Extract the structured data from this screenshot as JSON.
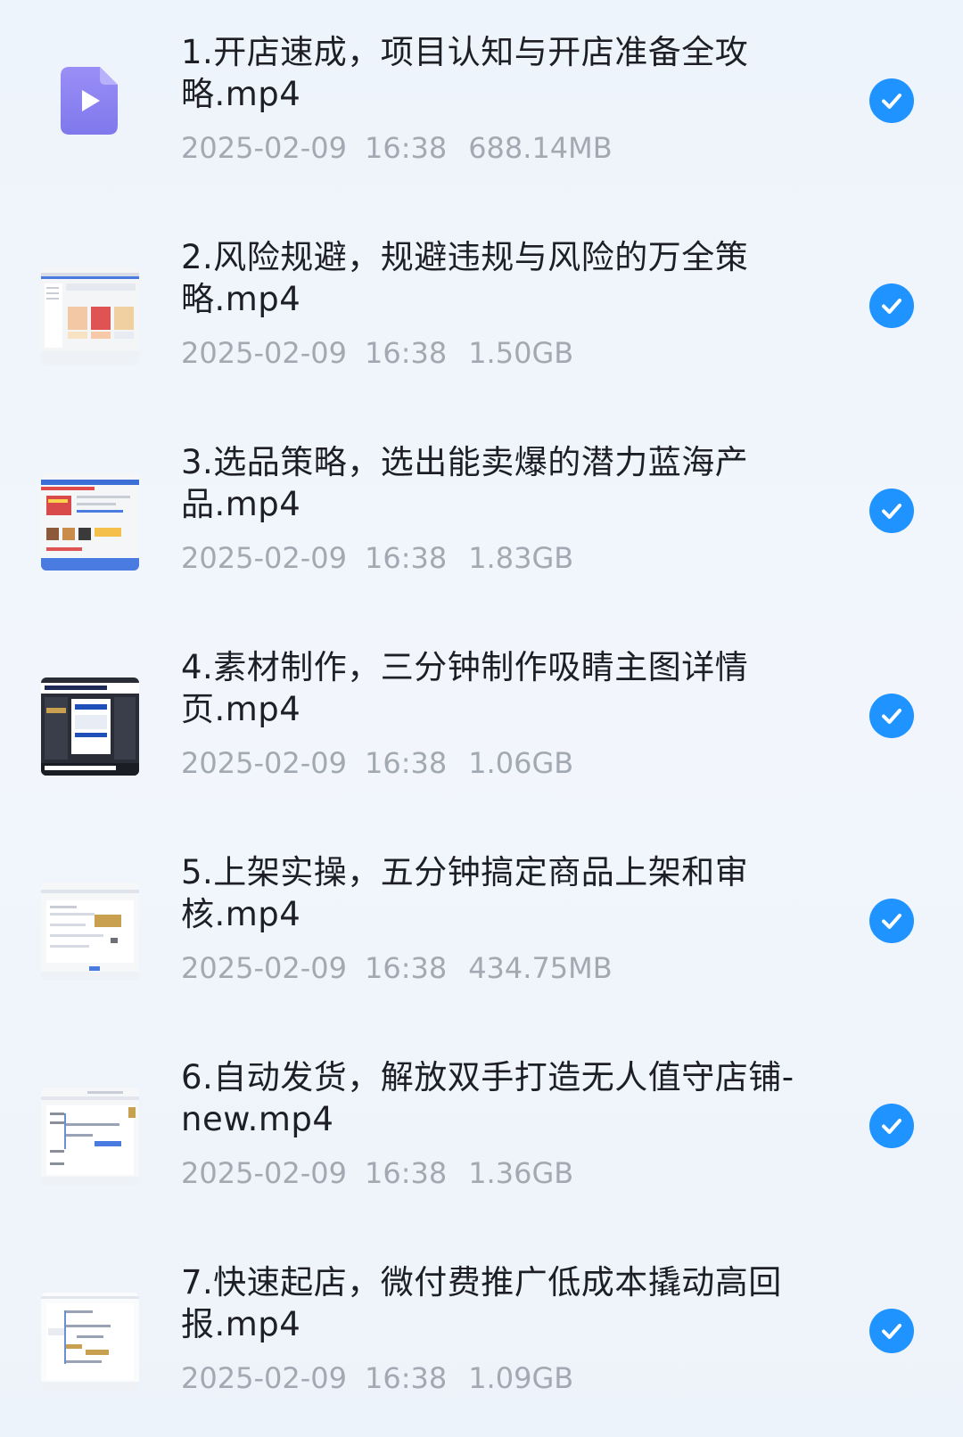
{
  "files": [
    {
      "name": "1.开店速成，项目认知与开店准备全攻略.mp4",
      "date": "2025-02-09",
      "time": "16:38",
      "size": "688.14MB",
      "thumb": "video-file-icon",
      "selected": true
    },
    {
      "name": "2.风险规避，规避违规与风险的万全策略.mp4",
      "date": "2025-02-09",
      "time": "16:38",
      "size": "1.50GB",
      "thumb": "video-thumbnail",
      "selected": true
    },
    {
      "name": "3.选品策略，选出能卖爆的潜力蓝海产品.mp4",
      "date": "2025-02-09",
      "time": "16:38",
      "size": "1.83GB",
      "thumb": "video-thumbnail",
      "selected": true
    },
    {
      "name": "4.素材制作，三分钟制作吸睛主图详情页.mp4",
      "date": "2025-02-09",
      "time": "16:38",
      "size": "1.06GB",
      "thumb": "video-thumbnail",
      "selected": true
    },
    {
      "name": "5.上架实操，五分钟搞定商品上架和审核.mp4",
      "date": "2025-02-09",
      "time": "16:38",
      "size": "434.75MB",
      "thumb": "video-thumbnail",
      "selected": true
    },
    {
      "name": "6.自动发货，解放双手打造无人值守店铺-new.mp4",
      "date": "2025-02-09",
      "time": "16:38",
      "size": "1.36GB",
      "thumb": "video-thumbnail",
      "selected": true
    },
    {
      "name": "7.快速起店，微付费推广低成本撬动高回报.mp4",
      "date": "2025-02-09",
      "time": "16:38",
      "size": "1.09GB",
      "thumb": "video-thumbnail",
      "selected": true
    }
  ],
  "colors": {
    "background": "#eef4fb",
    "title_text": "#1d1f24",
    "meta_text": "#a3a9b2",
    "check_blue": "#1f93ff",
    "video_icon": "#8f86f2"
  }
}
